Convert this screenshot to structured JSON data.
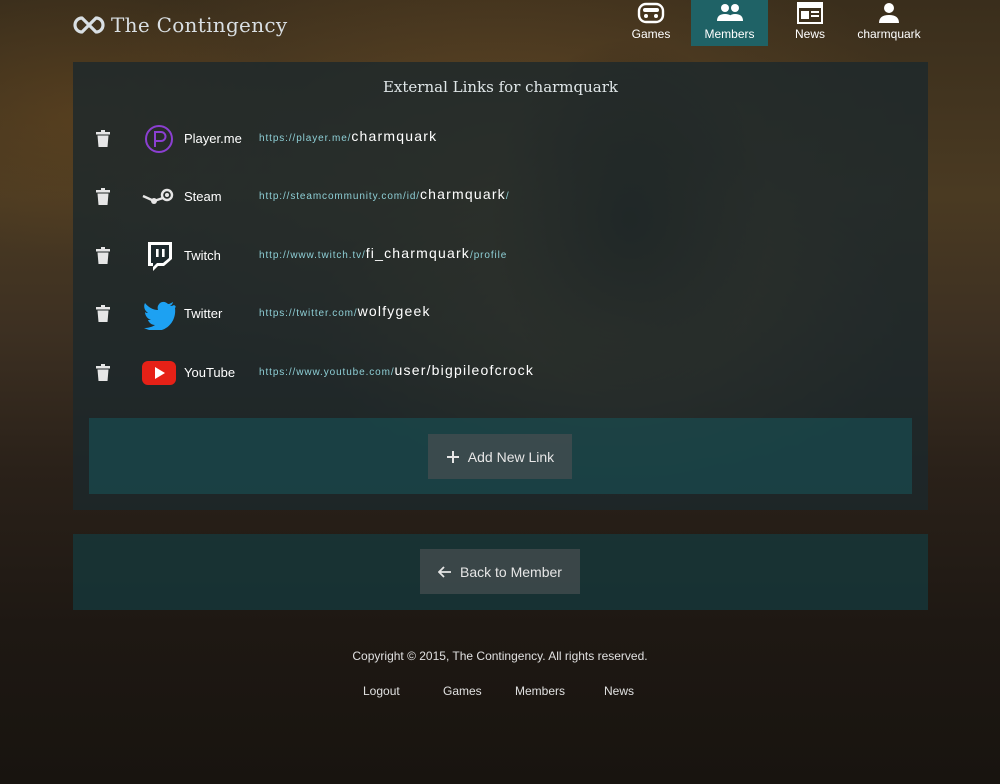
{
  "brand": {
    "name": "The Contingency"
  },
  "nav": [
    {
      "label": "Games",
      "icon": "gamepad-icon"
    },
    {
      "label": "Members",
      "icon": "members-icon",
      "active": true
    },
    {
      "label": "News",
      "icon": "newspaper-icon"
    },
    {
      "label": "charmquark",
      "icon": "user-icon"
    }
  ],
  "panel": {
    "title": "External Links for charmquark",
    "links": [
      {
        "service": "Player.me",
        "url_prefix": "https://player.me/",
        "username": "charmquark",
        "url_suffix": "",
        "icon": "playerme-icon"
      },
      {
        "service": "Steam",
        "url_prefix": "http://steamcommunity.com/id/",
        "username": "charmquark",
        "url_suffix": "/",
        "icon": "steam-icon"
      },
      {
        "service": "Twitch",
        "url_prefix": "http://www.twitch.tv/",
        "username": "fi_charmquark",
        "url_suffix": "/profile",
        "icon": "twitch-icon"
      },
      {
        "service": "Twitter",
        "url_prefix": "https://twitter.com/",
        "username": "wolfygeek",
        "url_suffix": "",
        "icon": "twitter-icon"
      },
      {
        "service": "YouTube",
        "url_prefix": "https://www.youtube.com/",
        "username": "user/bigpileofcrock",
        "url_suffix": "",
        "icon": "youtube-icon"
      }
    ],
    "add_button": "Add New Link"
  },
  "back_button": "Back to Member",
  "footer": {
    "copyright": "Copyright © 2015, The Contingency. All rights reserved.",
    "links": [
      "Logout",
      "Games",
      "Members",
      "News"
    ]
  },
  "colors": {
    "accent": "#1f6266",
    "link": "#8ecfd6",
    "twitch": "#ffffff",
    "twitter": "#1da1f2",
    "youtube": "#e62117",
    "playerme": "#8b3fd1"
  }
}
